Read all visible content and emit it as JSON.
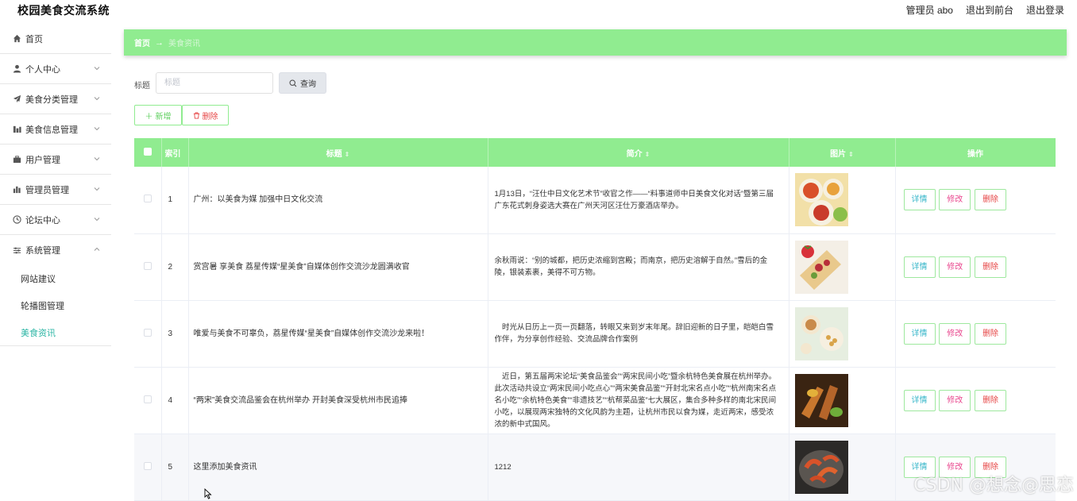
{
  "header": {
    "app_title": "校园美食交流系统",
    "admin_user": "管理员 abo",
    "to_front": "退出到前台",
    "logout": "退出登录"
  },
  "sidebar": {
    "items": [
      {
        "label": "首页",
        "icon": "home-icon"
      },
      {
        "label": "个人中心",
        "icon": "user-icon"
      },
      {
        "label": "美食分类管理",
        "icon": "paper-plane-icon"
      },
      {
        "label": "美食信息管理",
        "icon": "bar-chart-icon"
      },
      {
        "label": "用户管理",
        "icon": "briefcase-icon"
      },
      {
        "label": "管理员管理",
        "icon": "column-chart-icon"
      },
      {
        "label": "论坛中心",
        "icon": "clock-icon"
      },
      {
        "label": "系统管理",
        "icon": "sliders-icon"
      }
    ],
    "sub_items": [
      "网站建议",
      "轮播图管理",
      "美食资讯"
    ]
  },
  "breadcrumb": {
    "home": "首页",
    "separator": "→",
    "current": "美食资讯"
  },
  "search": {
    "label": "标题",
    "placeholder": "标题",
    "value": "",
    "button_label": "查询"
  },
  "actions": {
    "add_label": "新增",
    "delete_label": "删除"
  },
  "table": {
    "columns": [
      "索引",
      "标题",
      "简介",
      "图片",
      "操作"
    ],
    "detail_label": "详情",
    "edit_label": "修改",
    "remove_label": "删除",
    "rows": [
      {
        "index": "1",
        "title": "广州：以美食为媒 加强中日文化交流",
        "intro": "1月13日，“汪仕中日文化艺术节”收官之作——“料事道师中日美食文化对话”暨第三届广东花式刺身姿选大赛在广州天河区汪仕万豪酒店举办。"
      },
      {
        "index": "2",
        "title": "赏宫暑 享美食 荔星传媒“星美食”自媒体创作交流沙龙圆满收官",
        "intro": "余秋雨说：“别的城都，把历史浓缩到宫殿；而南京，把历史溶解于自然。”雪后的金陵，银装素裹，美得不可方物。"
      },
      {
        "index": "3",
        "title": "唯爱与美食不可辜负，荔星传媒“星美食”自媒体创作交流沙龙来啦！",
        "intro": "　时光从日历上一页一页翻落，转眼又来到岁末年尾。辞旧迎新的日子里，皑皑白雪作伴，为分享创作经验、交流品牌合作案例"
      },
      {
        "index": "4",
        "title": "“两宋”美食交流品鉴会在杭州举办 开封美食深受杭州市民追捧",
        "intro": "　近日，第五届两宋论坛“美食品鉴会”“两宋民间小吃”暨余杭特色美食展在杭州举办。此次活动共设立“两宋民间小吃点心”“两宋美食品鉴”“开封北宋名点小吃”“杭州南宋名点名小吃”“余杭特色美食”“非遗技艺”“杭帮菜品鉴”七大展区，集合多种多样的南北宋民间小吃，以展现两宋独特的文化风韵为主题，让杭州市民以食为媒，走近两宋，感受浓浓的新中式国风。"
      },
      {
        "index": "5",
        "title": "这里添加美食资讯",
        "intro": "1212"
      }
    ]
  },
  "watermark": "CSDN @想念@思恋"
}
